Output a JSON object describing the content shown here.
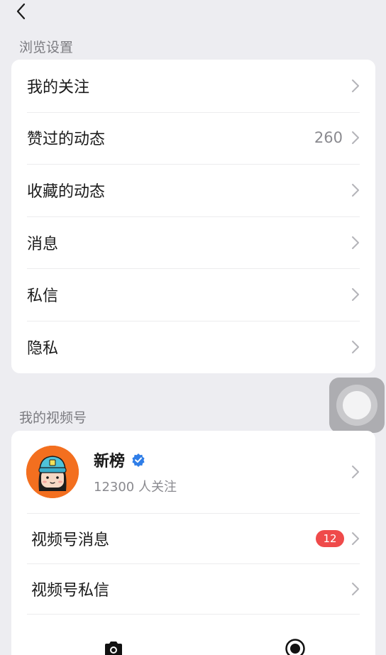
{
  "nav": {
    "back_icon": "chevron-left-icon"
  },
  "browse": {
    "title": "浏览设置",
    "items": [
      {
        "label": "我的关注",
        "count": ""
      },
      {
        "label": "赞过的动态",
        "count": "260"
      },
      {
        "label": "收藏的动态",
        "count": ""
      },
      {
        "label": "消息",
        "count": ""
      },
      {
        "label": "私信",
        "count": ""
      },
      {
        "label": "隐私",
        "count": ""
      }
    ]
  },
  "channel": {
    "title": "我的视频号",
    "profile": {
      "name": "新榜",
      "followers": "12300 人关注",
      "avatar_color": "#f36f1f",
      "verified_color": "#2f7ee8"
    },
    "items": [
      {
        "label": "视频号消息",
        "badge": "12"
      },
      {
        "label": "视频号私信",
        "badge": ""
      }
    ]
  },
  "bottom": {
    "left_icon": "camera-icon",
    "right_icon": "record-icon"
  },
  "colors": {
    "background": "#ededf1",
    "card": "#ffffff",
    "badge": "#ef4a4a",
    "accent": "#2f7ee8"
  }
}
